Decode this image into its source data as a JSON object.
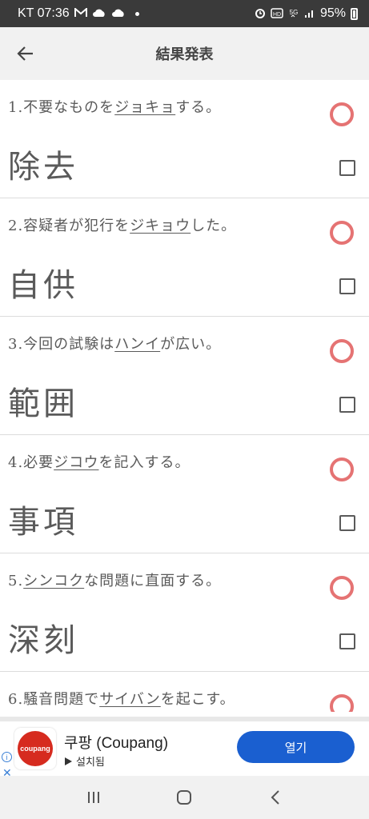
{
  "status_bar": {
    "carrier_time": "KT 07:36",
    "icons_left": [
      "gmail-icon",
      "cloud-icon",
      "cloud-icon",
      "dot-icon"
    ],
    "icons_right": [
      "alarm-icon",
      "hd-icon",
      "5g-icon",
      "signal-icon"
    ],
    "battery": "95%"
  },
  "app_bar": {
    "title": "結果発表",
    "back_icon": "arrow-left-icon"
  },
  "items": [
    {
      "prefix": "1.不要なものを",
      "katakana": "ジョキョ",
      "suffix": "する。",
      "answer": "除去"
    },
    {
      "prefix": "2.容疑者が犯行を",
      "katakana": "ジキョウ",
      "suffix": "した。",
      "answer": "自供"
    },
    {
      "prefix": "3.今回の試験は",
      "katakana": "ハンイ",
      "suffix": "が広い。",
      "answer": "範囲"
    },
    {
      "prefix": "4.必要",
      "katakana": "ジコウ",
      "suffix": "を記入する。",
      "answer": "事項"
    },
    {
      "prefix": "5.",
      "katakana": "シンコク",
      "suffix": "な問題に直面する。",
      "answer": "深刻"
    },
    {
      "prefix": "6.騒音問題で",
      "katakana": "サイバン",
      "suffix": "を起こす。",
      "answer": ""
    }
  ],
  "ad": {
    "logo_text": "coupang",
    "title": "쿠팡 (Coupang)",
    "subtitle": "설치됨",
    "button": "열기",
    "info": "i",
    "close": "✕"
  },
  "colors": {
    "status_bar_bg": "#3a3a3a",
    "app_bar_bg": "#f1f1f1",
    "correct_circle": "#e57373",
    "ad_button": "#1a5fd0"
  }
}
